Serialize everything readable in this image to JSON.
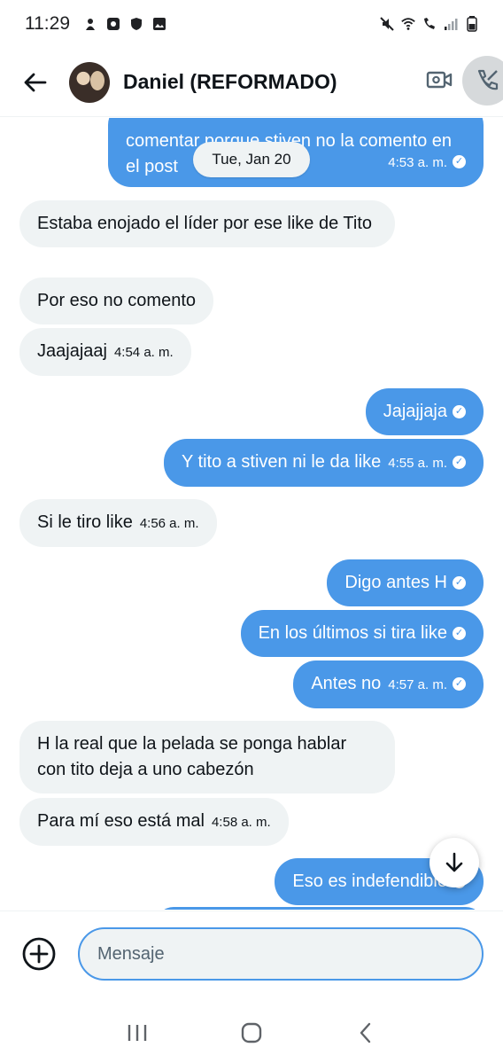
{
  "status_bar": {
    "time": "11:29"
  },
  "header": {
    "contact_name": "Daniel (REFORMADO)"
  },
  "conversation": {
    "date_separator": "Tue, Jan 20",
    "messages": [
      {
        "dir": "out",
        "text": "comentar porque stiven no la comento en el post",
        "time": "4:53 a. m."
      },
      {
        "dir": "in",
        "text": "Estaba enojado el líder por ese like de Tito",
        "time": ""
      },
      {
        "dir": "in",
        "text": "Por eso no comento",
        "time": ""
      },
      {
        "dir": "in",
        "text": "Jaajajaaj",
        "time": "4:54 a. m."
      },
      {
        "dir": "out",
        "text": "Jajajjaja",
        "time": ""
      },
      {
        "dir": "out",
        "text": "Y tito a stiven ni le da like",
        "time": "4:55 a. m."
      },
      {
        "dir": "in",
        "text": "Si le tiro like",
        "time": "4:56 a. m."
      },
      {
        "dir": "out",
        "text": "Digo antes H",
        "time": ""
      },
      {
        "dir": "out",
        "text": "En los últimos si tira like",
        "time": ""
      },
      {
        "dir": "out",
        "text": "Antes no",
        "time": "4:57 a. m."
      },
      {
        "dir": "in",
        "text": "H la real que la pelada se ponga hablar con tito deja a uno cabezón",
        "time": ""
      },
      {
        "dir": "in",
        "text": "Para mí eso está mal",
        "time": "4:58 a. m."
      },
      {
        "dir": "out",
        "text": "Eso es indefendible",
        "time": ""
      }
    ]
  },
  "composer": {
    "placeholder": "Mensaje"
  },
  "icons": {
    "back": "arrow-left-icon",
    "video": "video-call-icon",
    "call": "phone-call-icon",
    "add": "add-circle-icon",
    "scroll": "arrow-down-icon"
  },
  "colors": {
    "outgoing_bubble": "#4a98e8",
    "incoming_bubble": "#eff3f4"
  }
}
